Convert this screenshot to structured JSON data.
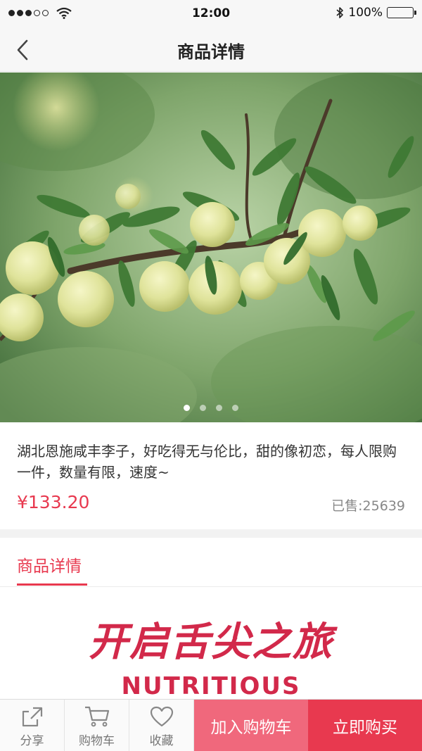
{
  "status_bar": {
    "time": "12:00",
    "battery": "100%",
    "icons": [
      "signal-dots",
      "wifi-icon",
      "bluetooth-icon",
      "battery-icon"
    ]
  },
  "nav": {
    "title": "商品详情",
    "back_icon": "chevron-left-icon"
  },
  "gallery": {
    "total": 4,
    "active_index": 0
  },
  "product": {
    "title": "湖北恩施咸丰李子，好吃得无与伦比，甜的像初恋，每人限购一件，数量有限，速度~",
    "price": "¥133.20",
    "sold": "已售:25639"
  },
  "detail": {
    "tab_label": "商品详情",
    "banner_title": "开启舌尖之旅",
    "banner_subtitle": "NUTRITIOUS"
  },
  "bottom_bar": {
    "share_label": "分享",
    "cart_label": "购物车",
    "favorite_label": "收藏",
    "add_to_cart_label": "加入购物车",
    "buy_now_label": "立即购买"
  },
  "colors": {
    "accent": "#e8394f",
    "accent_light": "#f0687c",
    "banner": "#d2294a"
  }
}
